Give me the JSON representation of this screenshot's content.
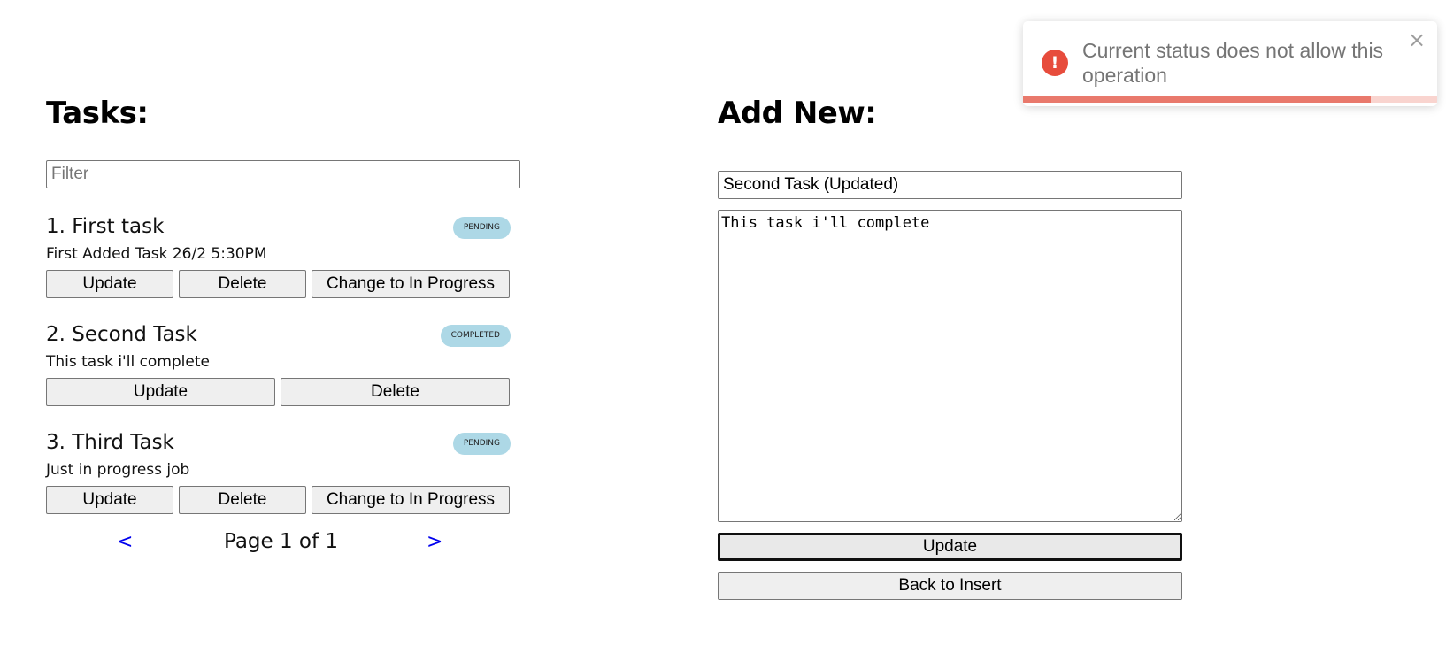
{
  "tasks_section": {
    "heading": "Tasks:",
    "filter_placeholder": "Filter"
  },
  "tasks": [
    {
      "title": "1. First task",
      "status": "PENDING",
      "description": "First Added Task 26/2 5:30PM",
      "update_label": "Update",
      "delete_label": "Delete",
      "change_label": "Change to In Progress"
    },
    {
      "title": "2. Second Task",
      "status": "COMPLETED",
      "description": "This task i'll complete",
      "update_label": "Update",
      "delete_label": "Delete"
    },
    {
      "title": "3. Third Task",
      "status": "PENDING",
      "description": "Just in progress job",
      "update_label": "Update",
      "delete_label": "Delete",
      "change_label": "Change to In Progress"
    }
  ],
  "pagination": {
    "prev": "<",
    "text": "Page 1 of 1",
    "next": ">"
  },
  "form": {
    "heading": "Add New:",
    "title_value": "Second Task (Updated)",
    "description_value": "This task i'll complete",
    "update_label": "Update",
    "back_label": "Back to Insert"
  },
  "toast": {
    "message": "Current status does not allow this operation",
    "icon": "error-icon",
    "close": "×",
    "icon_glyph": "!",
    "progress": 0.84,
    "color": "#e74c3c"
  }
}
